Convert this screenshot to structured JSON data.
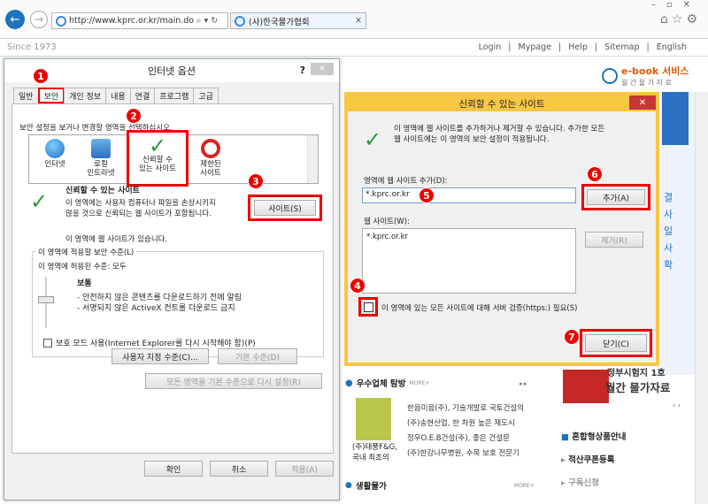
{
  "browser": {
    "url": "http://www.kprc.or.kr/main.do",
    "url_icons": "⌕ ▾ ↻",
    "tab_title": "(사)한국물가협회",
    "back_icon": "←",
    "fwd_icon": "→",
    "tab_close": "✕"
  },
  "site": {
    "since": "Since 1973",
    "links": [
      "Login",
      "Mypage",
      "Help",
      "Sitemap",
      "English"
    ],
    "separators": "|",
    "ebook": "e-book 서비스",
    "ebook_sub": "월 간  물 가 자 료",
    "vertical": [
      "결",
      "사",
      "일",
      "사",
      "확"
    ],
    "section1_title": "우수업체 탐방",
    "more": "MORE+",
    "companies": [
      "한음미음(주), 기술개발로 국토건설의",
      "(주)송현산업, 한 차원 높은 제도시",
      "정우O.E.B건설(주), 좋은 건설문",
      "(주)한강나무병원, 수목 보호 전문기"
    ],
    "caption1": "(주)태풍F&G,",
    "caption2": "국내 최초의",
    "banner1": "정부시험지 1호",
    "banner2": "월간 물가자료",
    "right_links": [
      "혼합형상품안내",
      "적산쿠폰등록",
      "구독신청"
    ],
    "section2_title": "생활물가"
  },
  "options": {
    "title": "인터넷 옵션",
    "help_btn": "?",
    "close_btn": "✕",
    "tabs": [
      "일반",
      "보안",
      "개인 정보",
      "내용",
      "연결",
      "프로그램",
      "고급"
    ],
    "instr": "보안 설정을 보거나 변경할 영역을 선택하십시오.",
    "zones": [
      {
        "line1": "인터넷",
        "line2": ""
      },
      {
        "line1": "로컬",
        "line2": "인트라넷"
      },
      {
        "line1": "신뢰할 수",
        "line2": "있는 사이트"
      },
      {
        "line1": "제한된",
        "line2": "사이트"
      }
    ],
    "zone_title": "신뢰할 수 있는 사이트",
    "zone_desc1": "이 영역에는 사용자 컴퓨터나 파일을 손상시키지",
    "zone_desc2": "않을 것으로 신뢰되는 웹 사이트가 포함됩니다.",
    "zone_has": "이 영역에 웹 사이트가 있습니다.",
    "sites_btn": "사이트(S)",
    "level_group": "이 영역에 적용할 보안 수준(L)",
    "level_allowed": "이 영역에 허용된 수준: 모두",
    "level_name": "보통",
    "level_b1": "- 안전하지 않은 콘텐츠를 다운로드하기 전에 알림",
    "level_b2": "- 서명되지 않은 ActiveX 컨트롤 다운로드 금지",
    "protect": "보호 모드 사용(Internet Explorer를 다시 시작해야 함)(P)",
    "custom_btn": "사용자 지정 수준(C)...",
    "default_btn": "기본 수준(D)",
    "reset_all_btn": "모든 영역을 기본 수준으로 다시 설정(R)",
    "ok": "확인",
    "cancel": "취소",
    "apply": "적용(A)"
  },
  "trusted": {
    "title": "신뢰할 수 있는 사이트",
    "close_btn": "✕",
    "desc1": "이 영역에 웹 사이트를 추가하거나 제거할 수 있습니다. 추가한 모든",
    "desc2": "웹 사이트에는 이 영역의 보안 설정이 적용됩니다.",
    "add_label": "영역에 웹 사이트 추가(D):",
    "add_value": "*.kprc.or.kr",
    "add_btn": "추가(A)",
    "sites_label": "웹 사이트(W):",
    "sites": [
      "*.kprc.or.kr"
    ],
    "remove_btn": "제거(R)",
    "verify": "이 영역에 있는 모든 사이트에 대해 서버 검증(https:) 필요(S)",
    "close": "닫기(C)"
  },
  "steps": [
    "1",
    "2",
    "3",
    "4",
    "5",
    "6",
    "7"
  ],
  "colors": {
    "highlight": "#e00000",
    "dialog_border": "#f7c744",
    "ie_blue": "#1e73be",
    "check_green": "#2a9a3a"
  }
}
